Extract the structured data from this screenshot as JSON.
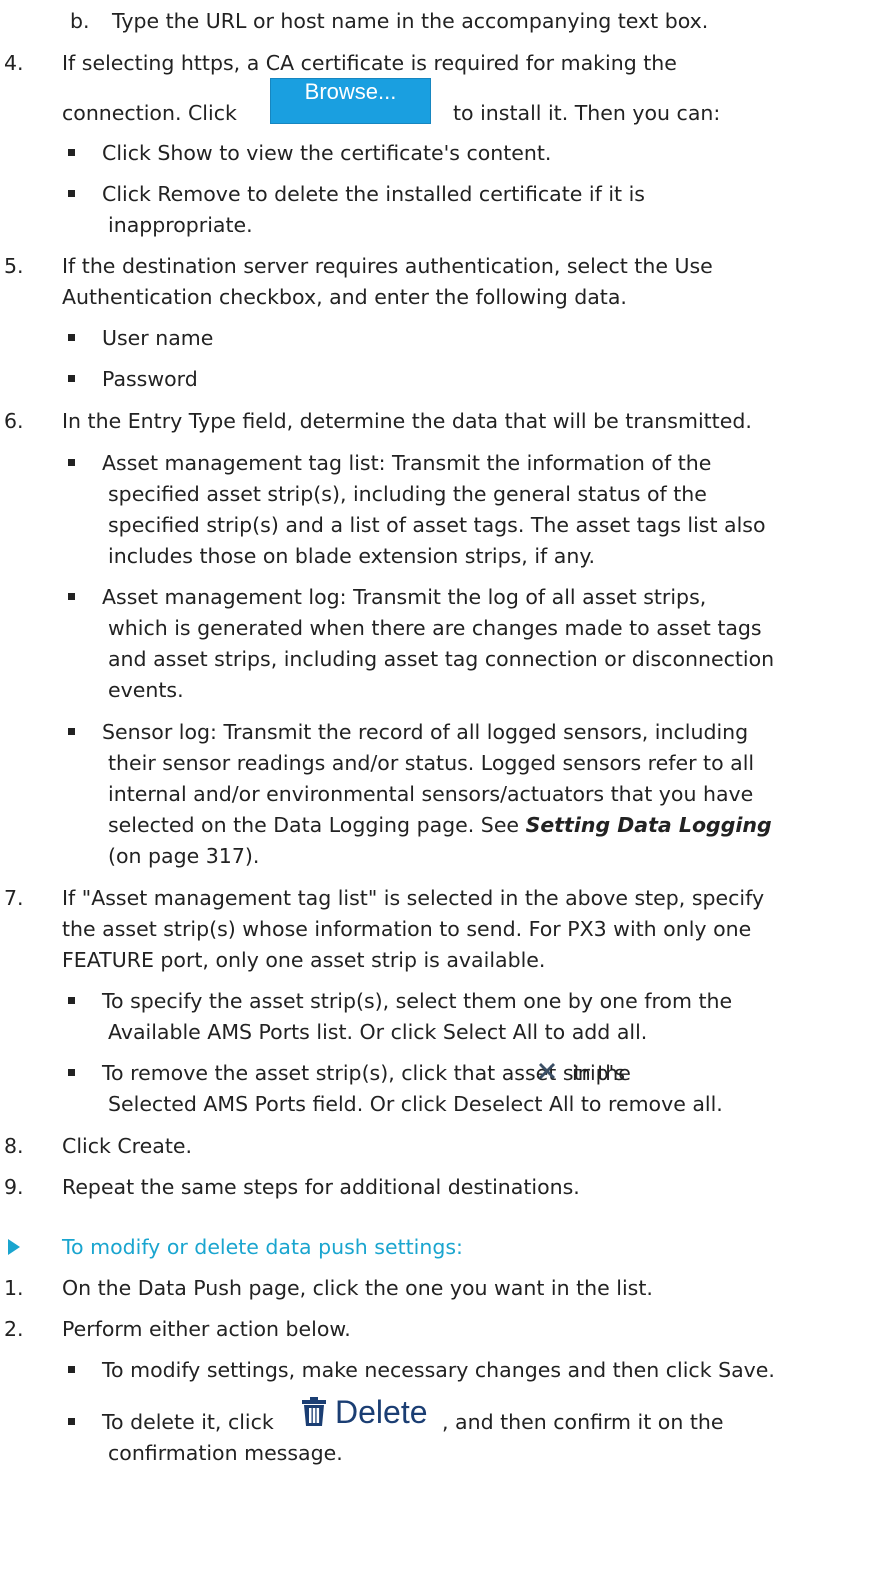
{
  "step3b": {
    "marker": "b.",
    "text": "Type the URL or host name in the accompanying text box."
  },
  "step4": {
    "num": "4.",
    "line1": "If selecting https, a CA certificate is required for making the",
    "line2_pre": "connection. Click",
    "browse_label": "Browse...",
    "line2_post": "to install it. Then you can:",
    "bullets": [
      "Click Show to view the certificate's content.",
      "Click Remove to delete the installed certificate if it is",
      "inappropriate."
    ]
  },
  "step5": {
    "num": "5.",
    "line1": "If the destination server requires authentication, select the Use",
    "line2": "Authentication checkbox, and enter the following data.",
    "bullets": [
      "User name",
      "Password"
    ]
  },
  "step6": {
    "num": "6.",
    "line1": "In the Entry Type field, determine the data that will be transmitted.",
    "b1": [
      "Asset management tag list: Transmit the information of the",
      "specified asset strip(s), including the general status of the",
      "specified strip(s) and a list of asset tags. The asset tags list also",
      "includes those on blade extension strips, if any."
    ],
    "b2": [
      "Asset management log: Transmit the log of all asset strips,",
      "which is generated when there are changes made to asset tags",
      "and asset strips, including asset tag connection or disconnection",
      "events."
    ],
    "b3": [
      "Sensor log: Transmit the record of all logged sensors, including",
      "their sensor readings and/or status. Logged sensors refer to all",
      "internal and/or environmental sensors/actuators that you have"
    ],
    "b3_line4_pre": "selected on the Data Logging page. See",
    "b3_link": "Setting Data Logging",
    "b3_line5": "(on page 317)."
  },
  "step7": {
    "num": "7.",
    "line1": "If \"Asset management tag list\" is selected in the above step, specify",
    "line2": "the asset strip(s) whose information to send. For PX3 with only one",
    "line3": "FEATURE port, only one asset strip is available.",
    "b1": [
      "To specify the asset strip(s), select them one by one from the",
      "Available AMS Ports list. Or click Select All to add all."
    ],
    "b2_pre": "To remove the asset strip(s), click that asset strip's",
    "b2_post": "in the",
    "b2_line2": "Selected AMS Ports field. Or click Deselect All to remove all."
  },
  "step8": {
    "num": "8.",
    "text": "Click Create."
  },
  "step9": {
    "num": "9.",
    "text": "Repeat the same steps for additional destinations."
  },
  "section_heading": "To modify or delete data push settings:",
  "mod1": {
    "num": "1.",
    "text": "On the Data Push page, click the one you want in the list."
  },
  "mod2": {
    "num": "2.",
    "text": "Perform either action below.",
    "b1": "To modify settings, make necessary changes and then click Save.",
    "b2_pre": "To delete it, click",
    "delete_label": "Delete",
    "b2_post": ", and then confirm it on the",
    "b2_line2": "confirmation message."
  },
  "colors": {
    "heading": "#1aa5cf",
    "browse_button": "#1a9fe0",
    "delete_icon": "#1b3e73"
  }
}
